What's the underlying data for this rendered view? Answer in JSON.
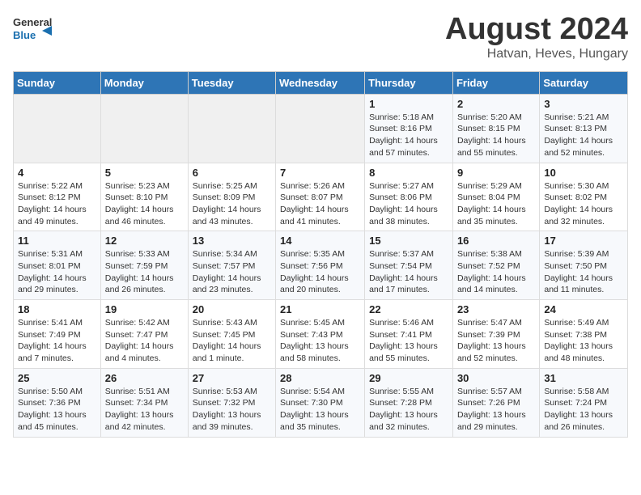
{
  "header": {
    "logo_line1": "General",
    "logo_line2": "Blue",
    "title": "August 2024",
    "subtitle": "Hatvan, Heves, Hungary"
  },
  "weekdays": [
    "Sunday",
    "Monday",
    "Tuesday",
    "Wednesday",
    "Thursday",
    "Friday",
    "Saturday"
  ],
  "weeks": [
    [
      {
        "day": "",
        "detail": ""
      },
      {
        "day": "",
        "detail": ""
      },
      {
        "day": "",
        "detail": ""
      },
      {
        "day": "",
        "detail": ""
      },
      {
        "day": "1",
        "detail": "Sunrise: 5:18 AM\nSunset: 8:16 PM\nDaylight: 14 hours\nand 57 minutes."
      },
      {
        "day": "2",
        "detail": "Sunrise: 5:20 AM\nSunset: 8:15 PM\nDaylight: 14 hours\nand 55 minutes."
      },
      {
        "day": "3",
        "detail": "Sunrise: 5:21 AM\nSunset: 8:13 PM\nDaylight: 14 hours\nand 52 minutes."
      }
    ],
    [
      {
        "day": "4",
        "detail": "Sunrise: 5:22 AM\nSunset: 8:12 PM\nDaylight: 14 hours\nand 49 minutes."
      },
      {
        "day": "5",
        "detail": "Sunrise: 5:23 AM\nSunset: 8:10 PM\nDaylight: 14 hours\nand 46 minutes."
      },
      {
        "day": "6",
        "detail": "Sunrise: 5:25 AM\nSunset: 8:09 PM\nDaylight: 14 hours\nand 43 minutes."
      },
      {
        "day": "7",
        "detail": "Sunrise: 5:26 AM\nSunset: 8:07 PM\nDaylight: 14 hours\nand 41 minutes."
      },
      {
        "day": "8",
        "detail": "Sunrise: 5:27 AM\nSunset: 8:06 PM\nDaylight: 14 hours\nand 38 minutes."
      },
      {
        "day": "9",
        "detail": "Sunrise: 5:29 AM\nSunset: 8:04 PM\nDaylight: 14 hours\nand 35 minutes."
      },
      {
        "day": "10",
        "detail": "Sunrise: 5:30 AM\nSunset: 8:02 PM\nDaylight: 14 hours\nand 32 minutes."
      }
    ],
    [
      {
        "day": "11",
        "detail": "Sunrise: 5:31 AM\nSunset: 8:01 PM\nDaylight: 14 hours\nand 29 minutes."
      },
      {
        "day": "12",
        "detail": "Sunrise: 5:33 AM\nSunset: 7:59 PM\nDaylight: 14 hours\nand 26 minutes."
      },
      {
        "day": "13",
        "detail": "Sunrise: 5:34 AM\nSunset: 7:57 PM\nDaylight: 14 hours\nand 23 minutes."
      },
      {
        "day": "14",
        "detail": "Sunrise: 5:35 AM\nSunset: 7:56 PM\nDaylight: 14 hours\nand 20 minutes."
      },
      {
        "day": "15",
        "detail": "Sunrise: 5:37 AM\nSunset: 7:54 PM\nDaylight: 14 hours\nand 17 minutes."
      },
      {
        "day": "16",
        "detail": "Sunrise: 5:38 AM\nSunset: 7:52 PM\nDaylight: 14 hours\nand 14 minutes."
      },
      {
        "day": "17",
        "detail": "Sunrise: 5:39 AM\nSunset: 7:50 PM\nDaylight: 14 hours\nand 11 minutes."
      }
    ],
    [
      {
        "day": "18",
        "detail": "Sunrise: 5:41 AM\nSunset: 7:49 PM\nDaylight: 14 hours\nand 7 minutes."
      },
      {
        "day": "19",
        "detail": "Sunrise: 5:42 AM\nSunset: 7:47 PM\nDaylight: 14 hours\nand 4 minutes."
      },
      {
        "day": "20",
        "detail": "Sunrise: 5:43 AM\nSunset: 7:45 PM\nDaylight: 14 hours\nand 1 minute."
      },
      {
        "day": "21",
        "detail": "Sunrise: 5:45 AM\nSunset: 7:43 PM\nDaylight: 13 hours\nand 58 minutes."
      },
      {
        "day": "22",
        "detail": "Sunrise: 5:46 AM\nSunset: 7:41 PM\nDaylight: 13 hours\nand 55 minutes."
      },
      {
        "day": "23",
        "detail": "Sunrise: 5:47 AM\nSunset: 7:39 PM\nDaylight: 13 hours\nand 52 minutes."
      },
      {
        "day": "24",
        "detail": "Sunrise: 5:49 AM\nSunset: 7:38 PM\nDaylight: 13 hours\nand 48 minutes."
      }
    ],
    [
      {
        "day": "25",
        "detail": "Sunrise: 5:50 AM\nSunset: 7:36 PM\nDaylight: 13 hours\nand 45 minutes."
      },
      {
        "day": "26",
        "detail": "Sunrise: 5:51 AM\nSunset: 7:34 PM\nDaylight: 13 hours\nand 42 minutes."
      },
      {
        "day": "27",
        "detail": "Sunrise: 5:53 AM\nSunset: 7:32 PM\nDaylight: 13 hours\nand 39 minutes."
      },
      {
        "day": "28",
        "detail": "Sunrise: 5:54 AM\nSunset: 7:30 PM\nDaylight: 13 hours\nand 35 minutes."
      },
      {
        "day": "29",
        "detail": "Sunrise: 5:55 AM\nSunset: 7:28 PM\nDaylight: 13 hours\nand 32 minutes."
      },
      {
        "day": "30",
        "detail": "Sunrise: 5:57 AM\nSunset: 7:26 PM\nDaylight: 13 hours\nand 29 minutes."
      },
      {
        "day": "31",
        "detail": "Sunrise: 5:58 AM\nSunset: 7:24 PM\nDaylight: 13 hours\nand 26 minutes."
      }
    ]
  ]
}
